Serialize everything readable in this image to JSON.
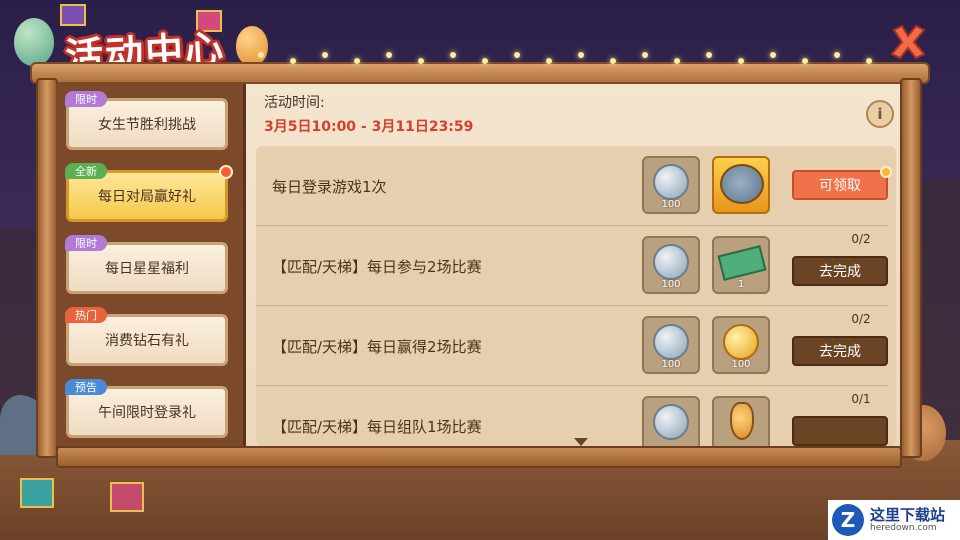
{
  "header": {
    "title": "活动中心",
    "close_icon": "close-x-icon"
  },
  "sidebar": {
    "items": [
      {
        "label": "女生节胜利挑战",
        "badge": "限时",
        "badge_color": "#b07ad6",
        "active": false,
        "notify": false
      },
      {
        "label": "每日对局赢好礼",
        "badge": "全新",
        "badge_color": "#5ab050",
        "active": true,
        "notify": true
      },
      {
        "label": "每日星星福利",
        "badge": "限时",
        "badge_color": "#b07ad6",
        "active": false,
        "notify": false
      },
      {
        "label": "消费钻石有礼",
        "badge": "热门",
        "badge_color": "#e8623a",
        "active": false,
        "notify": false
      },
      {
        "label": "午间限时登录礼",
        "badge": "预告",
        "badge_color": "#4a8ad6",
        "active": false,
        "notify": false
      }
    ]
  },
  "main": {
    "time_label": "活动时间:",
    "time_value": "3月5日10:00 - 3月11日23:59",
    "info_label": "i",
    "tasks": [
      {
        "name": "每日登录游戏1次",
        "rewards": [
          {
            "icon": "silver-coin-icon",
            "qty": "100"
          },
          {
            "icon": "tom-card-icon",
            "qty": ""
          }
        ],
        "progress": "",
        "action": "可领取"
      },
      {
        "name": "【匹配/天梯】每日参与2场比赛",
        "rewards": [
          {
            "icon": "silver-coin-icon",
            "qty": "100"
          },
          {
            "icon": "ticket-icon",
            "qty": "1"
          }
        ],
        "progress": "0/2",
        "action": "去完成"
      },
      {
        "name": "【匹配/天梯】每日赢得2场比赛",
        "rewards": [
          {
            "icon": "silver-coin-icon",
            "qty": "100"
          },
          {
            "icon": "gold-coin-icon",
            "qty": "100"
          }
        ],
        "progress": "0/2",
        "action": "去完成"
      },
      {
        "name": "【匹配/天梯】每日组队1场比赛",
        "rewards": [
          {
            "icon": "silver-coin-icon",
            "qty": ""
          },
          {
            "icon": "potion-bottle-icon",
            "qty": ""
          }
        ],
        "progress": "0/1",
        "action": ""
      }
    ]
  },
  "watermark": {
    "logo": "Z",
    "text": "这里下载站",
    "sub": "heredown.com"
  },
  "colors": {
    "accent_red": "#d5402e",
    "claim_button": "#f0724a",
    "go_button": "#6b4423",
    "active_tab": "#f5c84a"
  }
}
